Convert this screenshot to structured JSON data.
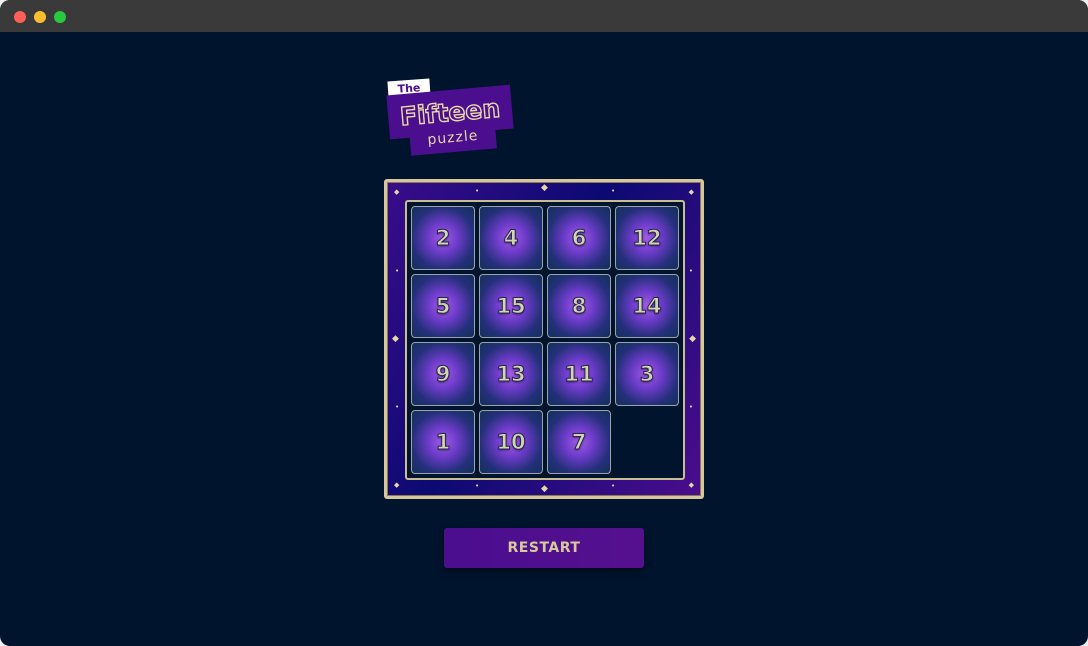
{
  "window": {
    "controls": [
      "close",
      "minimize",
      "zoom"
    ]
  },
  "logo": {
    "the": "The",
    "title": "Fifteen",
    "subtitle": "puzzle"
  },
  "board": {
    "rows": [
      [
        2,
        4,
        6,
        12
      ],
      [
        5,
        15,
        8,
        14
      ],
      [
        9,
        13,
        11,
        3
      ],
      [
        1,
        10,
        7,
        null
      ]
    ]
  },
  "restart_label": "RESTART",
  "colors": {
    "background": "#00142e",
    "brand_purple": "#4a0e8f",
    "gold": "#d6c79e",
    "tile_text": "#cfd6b2"
  }
}
